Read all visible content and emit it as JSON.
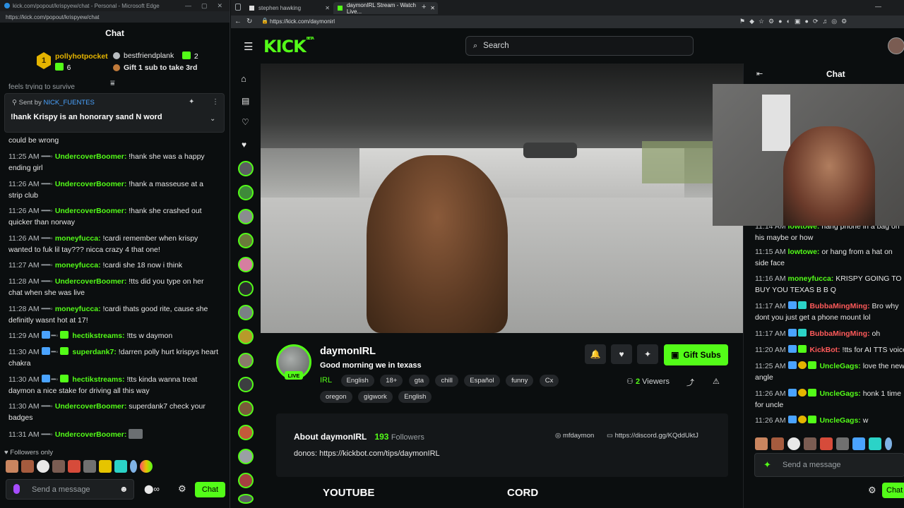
{
  "left_window": {
    "title": "kick.com/popout/krispyew/chat - Personal - Microsoft Edge",
    "url": "https://kick.com/popout/krispyew/chat",
    "chat_title": "Chat",
    "top_gifters": [
      {
        "rank": "1",
        "name": "pollyhotpocket",
        "count": "6"
      },
      {
        "name": "bestfriendplank",
        "count": "2"
      }
    ],
    "gift_prompt": "Gift 1 sub to take 3rd",
    "pinned": {
      "sent_by_label": "Sent by",
      "sender": "NICK_FUENTES",
      "text": "!hank Krispy is an honorary sand N word",
      "partial_line": "feels trying to survive"
    },
    "messages": [
      {
        "time": "",
        "user": "",
        "text": "could be wrong"
      },
      {
        "time": "11:25 AM",
        "user": "UndercoverBoomer:",
        "text": "!hank she was a happy ending girl"
      },
      {
        "time": "11:26 AM",
        "user": "UndercoverBoomer:",
        "text": "!hank a masseuse at a strip club"
      },
      {
        "time": "11:26 AM",
        "user": "UndercoverBoomer:",
        "text": "!hank she crashed out quicker than norway"
      },
      {
        "time": "11:26 AM",
        "user": "moneyfucca:",
        "text": "!cardi remember when krispy wanted to fuk lil tay??? nicca crazy 4 that one!"
      },
      {
        "time": "11:27 AM",
        "user": "moneyfucca:",
        "text": "!cardi she 18 now i think"
      },
      {
        "time": "11:28 AM",
        "user": "UndercoverBoomer:",
        "text": "!tts did you type on her chat when she was live"
      },
      {
        "time": "11:28 AM",
        "user": "moneyfucca:",
        "text": "!cardi thats good rite, cause she definitly wasnt hot at 17!"
      },
      {
        "time": "11:29 AM",
        "user": "hectikstreams:",
        "text": "!tts w daymon"
      },
      {
        "time": "11:30 AM",
        "user": "superdank7:",
        "text": "!darren polly hurt krispys heart chakra"
      },
      {
        "time": "11:30 AM",
        "user": "hectikstreams:",
        "text": "!tts kinda wanna treat daymon a nice stake for driving all this way"
      },
      {
        "time": "11:30 AM",
        "user": "UndercoverBoomer:",
        "text": "superdank7 check your badges"
      },
      {
        "time": "11:31 AM",
        "user": "UndercoverBoomer:",
        "text": ""
      }
    ],
    "followers_only": "Followers only",
    "send_placeholder": "Send a message",
    "chat_button": "Chat"
  },
  "right_window": {
    "tabs": [
      {
        "label": "stephen hawking"
      },
      {
        "label": "daymonIRL Stream - Watch Live..."
      }
    ],
    "url": "https://kick.com/daymonirl",
    "logo": "KICK",
    "logo_sup": "BETA",
    "search_placeholder": "Search",
    "right_chat_title": "Chat",
    "right_chat": [
      {
        "time": "11:14 AM",
        "user": "lowtowe:",
        "text": "hang phone in a bag on his maybe or how"
      },
      {
        "time": "11:15 AM",
        "user": "lowtowe:",
        "text": "or hang from a hat on side face"
      },
      {
        "time": "11:16 AM",
        "user": "moneyfucca:",
        "text": "KRISPY GOING TO BUY YOU TEXAS B B Q"
      },
      {
        "time": "11:17 AM",
        "user": "BubbaMingMing:",
        "text": "Bro why dont you just get a phone mount lol"
      },
      {
        "time": "11:17 AM",
        "user": "BubbaMingMing:",
        "text": "oh"
      },
      {
        "time": "11:20 AM",
        "user": "KickBot:",
        "text": "!tts for AI TTS voice"
      },
      {
        "time": "11:25 AM",
        "user": "UncleGags:",
        "text": "love the new angle"
      },
      {
        "time": "11:26 AM",
        "user": "UncleGags:",
        "text": "honk 1 time for uncle"
      },
      {
        "time": "11:26 AM",
        "user": "UncleGags:",
        "text": "w"
      }
    ],
    "right_send_placeholder": "Send a message",
    "right_chat_button": "Chat",
    "channel": {
      "name": "daymonIRL",
      "title": "Good morning we in texass",
      "live": "LIVE",
      "category": "IRL",
      "tags": [
        "English",
        "18+",
        "gta",
        "chill",
        "Español",
        "funny",
        "Cx"
      ],
      "tags2": [
        "oregon",
        "gigwork",
        "English"
      ],
      "viewers": "2",
      "viewers_label": "Viewers",
      "gift_subs": "Gift Subs"
    },
    "about": {
      "title": "About daymonIRL",
      "followers_count": "193",
      "followers_label": "Followers",
      "donos": "donos: https://kickbot.com/tips/daymonIRL",
      "instagram": "mfdaymon",
      "discord": "https://discord.gg/KQddUktJ"
    },
    "panels": [
      "YOUTUBE",
      "CORD"
    ]
  }
}
